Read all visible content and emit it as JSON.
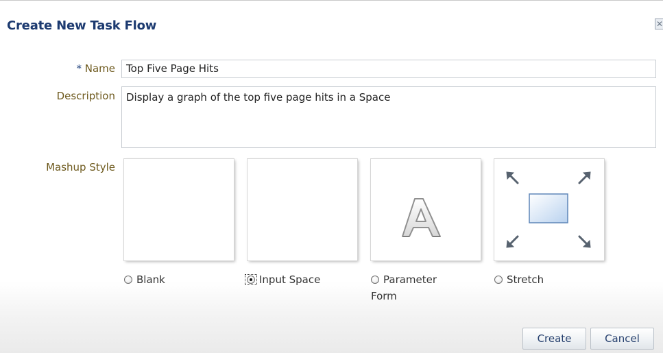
{
  "dialog": {
    "title": "Create New Task Flow",
    "close_glyph": "✕"
  },
  "form": {
    "name_required_mark": "*",
    "name_label": "Name",
    "name_value": "Top Five Page Hits",
    "description_label": "Description",
    "description_value": "Display a graph of the top five page hits in a Space",
    "mashup_label": "Mashup Style"
  },
  "mashup_options": [
    {
      "label": "Blank",
      "selected": false,
      "icon": "blank-preview"
    },
    {
      "label": "Input Space",
      "selected": true,
      "icon": "blank-preview"
    },
    {
      "label_line1": "Parameter",
      "label_line2": "Form",
      "selected": false,
      "icon": "letter-a-icon"
    },
    {
      "label": "Stretch",
      "selected": false,
      "icon": "stretch-arrows-icon"
    }
  ],
  "buttons": {
    "create": "Create",
    "cancel": "Cancel"
  },
  "colors": {
    "title": "#1c3a70",
    "label": "#6e5a1e",
    "button_text": "#26406e"
  }
}
